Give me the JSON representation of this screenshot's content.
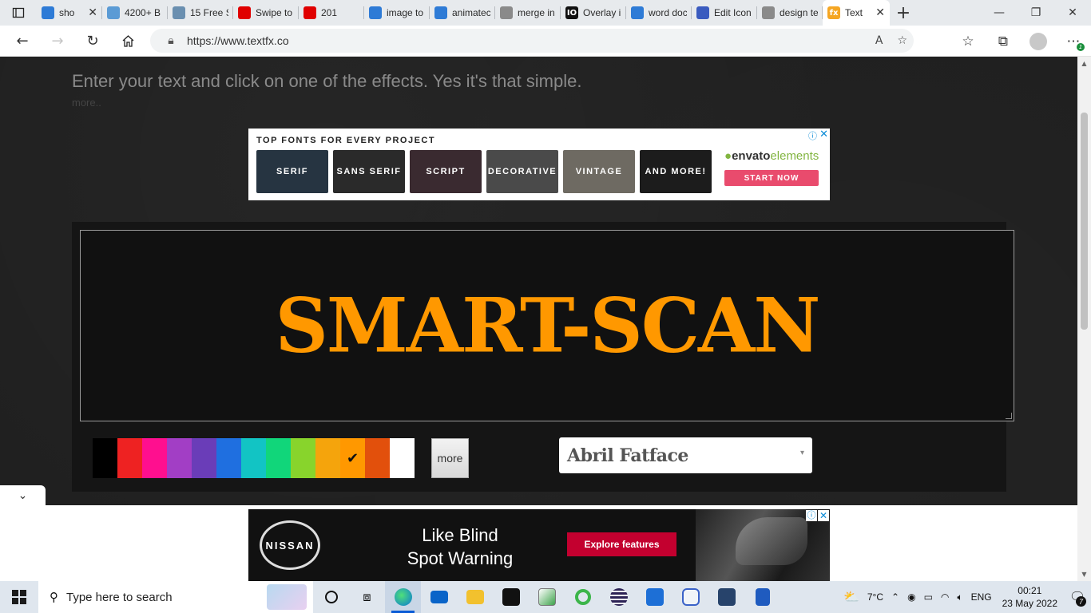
{
  "browser": {
    "tabs": [
      {
        "title": "sho",
        "icon": "bing-icon",
        "color": "#2e7bd6",
        "closable": true
      },
      {
        "title": "4200+ B",
        "icon": "image-icon",
        "color": "#5b9bd5",
        "closable": false
      },
      {
        "title": "15 Free S",
        "icon": "book-icon",
        "color": "#6a8fb0",
        "closable": false
      },
      {
        "title": "Swipe to",
        "icon": "youtube-icon",
        "color": "#e00000",
        "closable": false
      },
      {
        "title": "201",
        "icon": "youtube-icon",
        "color": "#e00000",
        "closable": false
      },
      {
        "title": "image to",
        "icon": "bing-icon",
        "color": "#2e7bd6",
        "closable": false
      },
      {
        "title": "animatec",
        "icon": "bing-icon",
        "color": "#2e7bd6",
        "closable": false
      },
      {
        "title": "merge in",
        "icon": "search-icon",
        "color": "#8a8a8a",
        "closable": false
      },
      {
        "title": "Overlay i",
        "icon": "io-icon",
        "color": "#111111",
        "closable": false
      },
      {
        "title": "word doc",
        "icon": "bing-icon",
        "color": "#2e7bd6",
        "closable": false
      },
      {
        "title": "Edit Icon",
        "icon": "star-icon",
        "color": "#3a5bbf",
        "closable": false
      },
      {
        "title": "design te",
        "icon": "search-icon",
        "color": "#8a8a8a",
        "closable": false
      },
      {
        "title": "Text",
        "icon": "fx-icon",
        "color": "#f5a623",
        "closable": true,
        "active": true
      }
    ],
    "url": "https://www.textfx.co",
    "fav_label": "fx",
    "io_label": "IO"
  },
  "page": {
    "subtitle": "Enter your text and click on one of the effects. Yes it's that simple.",
    "more_link": "more..",
    "editor_text": "SMART-SCAN",
    "more_button": "more",
    "font_selected": "Abril Fatface",
    "text_color": "#ff9800",
    "swatches": [
      "#000000",
      "#ee2222",
      "#ff0f8f",
      "#a23ec5",
      "#6a3db8",
      "#1f6fe0",
      "#12c4c4",
      "#11d67a",
      "#88d42c",
      "#f5a40c",
      "#ff9800",
      "#e2500c",
      "#ffffff"
    ],
    "selected_swatch_index": 10
  },
  "ad_top": {
    "title": "TOP FONTS FOR EVERY PROJECT",
    "tiles": [
      {
        "label": "SERIF",
        "bg": "#263441"
      },
      {
        "label": "SANS SERIF",
        "bg": "#2a2a2a"
      },
      {
        "label": "SCRIPT",
        "bg": "#3a2a30"
      },
      {
        "label": "DECORATIVE",
        "bg": "#4a4a4a"
      },
      {
        "label": "VINTAGE",
        "bg": "#6e6a62"
      },
      {
        "label": "AND MORE!",
        "bg": "#1c1c1c"
      }
    ],
    "brand_prefix": "envato",
    "brand_suffix": "elements",
    "cta": "START NOW"
  },
  "ad_bottom": {
    "brand": "NISSAN",
    "headline_line1": "Like Blind",
    "headline_line2": "Spot Warning",
    "cta": "Explore features"
  },
  "taskbar": {
    "search_placeholder": "Type here to search",
    "weather": "7°C",
    "language": "ENG",
    "time": "00:21",
    "date": "23 May 2022",
    "notifications": "7"
  }
}
